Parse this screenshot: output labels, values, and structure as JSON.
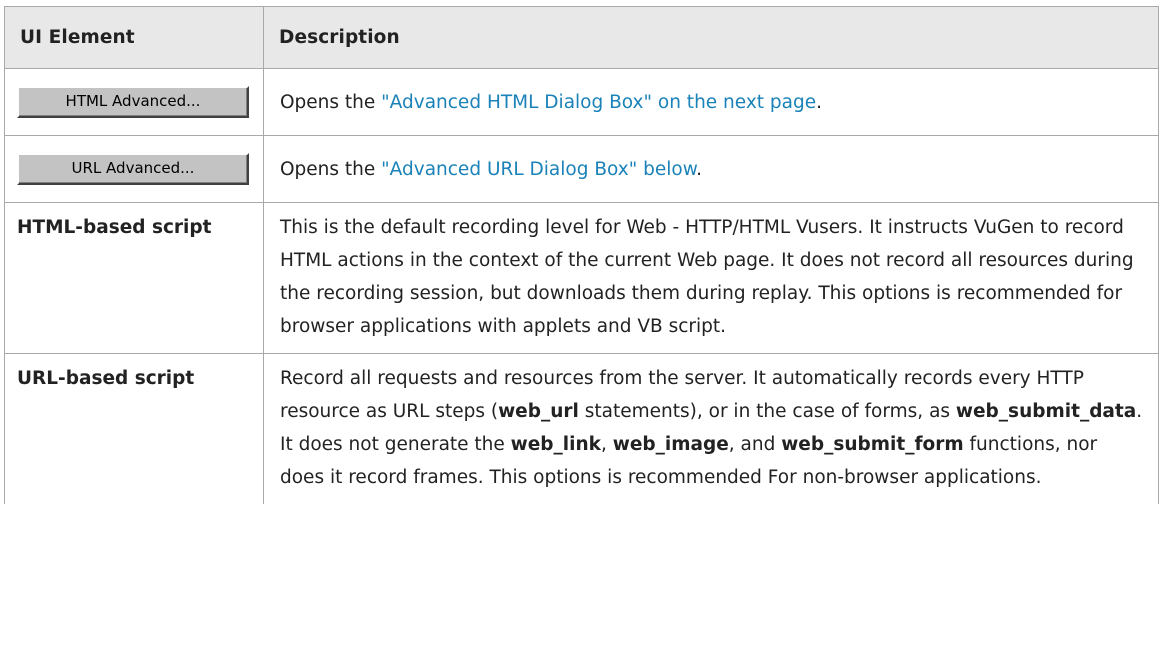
{
  "table": {
    "headers": {
      "ui_element": "UI Element",
      "description": "Description"
    },
    "rows": [
      {
        "element_button_label": "HTML Advanced...",
        "desc_prefix": "Opens the ",
        "desc_link": "\"Advanced HTML Dialog Box\" on the next page",
        "desc_suffix": "."
      },
      {
        "element_button_label": "URL Advanced...",
        "desc_prefix": "Opens the ",
        "desc_link": "\"Advanced URL Dialog Box\" below",
        "desc_suffix": "."
      },
      {
        "element_label": "HTML-based script",
        "description": "This is the default recording level for Web - HTTP/HTML Vusers. It instructs VuGen to record HTML actions in the context of the current Web page. It does not record all resources during the recording session, but downloads them during replay. This options is recommended for browser applications with applets and VB script."
      },
      {
        "element_label": "URL-based script",
        "desc_part1": "Record all requests and resources from the server. It automatically records every HTTP resource as URL steps (",
        "desc_bold1": "web_url",
        "desc_part2": " statements), or in the case of forms, as ",
        "desc_bold2": "web_submit_data",
        "desc_part3": ". It does not generate the ",
        "desc_bold3": "web_link",
        "desc_part4": ", ",
        "desc_bold4": "web_image",
        "desc_part5": ", and ",
        "desc_bold5": "web_submit_form",
        "desc_part6": " functions, nor does it record frames. This options is recommended For non-browser applications."
      }
    ]
  },
  "colors": {
    "header_bg": "#e8e8e8",
    "border": "#a9a9a9",
    "link": "#1a82b8",
    "button_face": "#c3c3c3"
  }
}
